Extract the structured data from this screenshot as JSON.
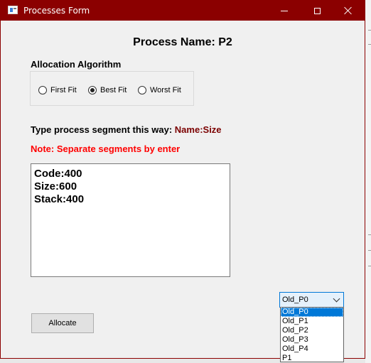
{
  "window": {
    "title": "Processes Form",
    "titlebar_color": "#8b0000"
  },
  "form": {
    "process_title": "Process Name: P2",
    "allocation_label": "Allocation Algorithm",
    "algorithms": [
      {
        "label": "First Fit",
        "checked": false
      },
      {
        "label": "Best Fit",
        "checked": true
      },
      {
        "label": "Worst Fit",
        "checked": false
      }
    ],
    "instruction_prefix": "Type process segment this way: ",
    "instruction_format": "Name:Size",
    "note": "Note: Separate segments by enter",
    "segments": [
      "Code:400",
      "Size:600",
      "Stack:400"
    ],
    "allocate_label": "Allocate",
    "process_select": {
      "selected": "Old_P0",
      "options": [
        "Old_P0",
        "Old_P1",
        "Old_P2",
        "Old_P3",
        "Old_P4",
        "P1"
      ]
    }
  },
  "colors": {
    "note_red": "#ff0000",
    "format_accent": "#7b0000",
    "selection_blue": "#0078d7"
  }
}
